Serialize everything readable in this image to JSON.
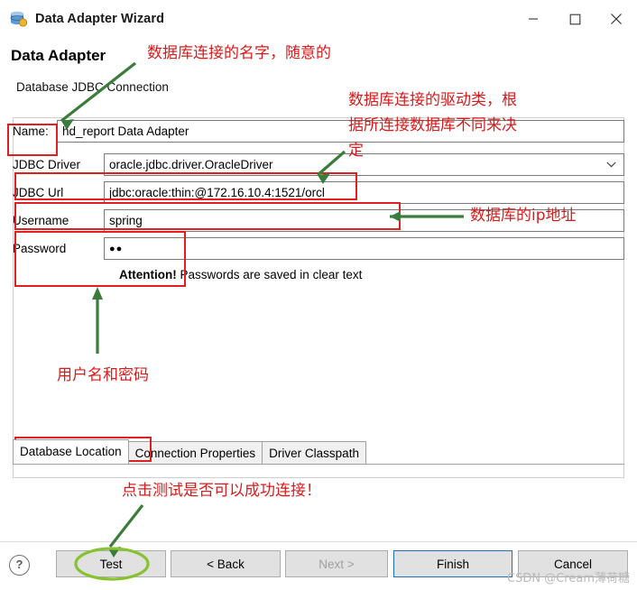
{
  "window": {
    "title": "Data Adapter Wizard",
    "icon": "database-adapter-icon",
    "minimize_label": "–",
    "maximize_label": "☐",
    "close_label": "✕"
  },
  "wizard": {
    "heading": "Data Adapter",
    "subheading": "Database JDBC Connection"
  },
  "form": {
    "name_label": "Name:",
    "name_value": "hd_report Data Adapter",
    "driver_label": "JDBC Driver",
    "driver_value": "oracle.jdbc.driver.OracleDriver",
    "driver_arrow": "⌄",
    "url_label": "JDBC Url",
    "url_value": "jdbc:oracle:thin:@172.16.10.4:1521/orcl",
    "username_label": "Username",
    "username_value": "spring",
    "password_label": "Password",
    "password_value": "●●",
    "attention_bold": "Attention!",
    "attention_text": "Passwords are saved in clear text"
  },
  "tabs": [
    {
      "label": "Database Location",
      "active": true
    },
    {
      "label": "Connection Properties",
      "active": false
    },
    {
      "label": "Driver Classpath",
      "active": false
    }
  ],
  "footer": {
    "help_label": "?",
    "test_label": "Test",
    "back_label": "< Back",
    "next_label": "Next >",
    "finish_label": "Finish",
    "cancel_label": "Cancel"
  },
  "annotations": {
    "note_name": "数据库连接的名字，随意的",
    "note_driver_line1": "数据库连接的驱动类，根",
    "note_driver_line2": "据所连接数据库不同来决",
    "note_driver_line3": "定",
    "note_url": "数据库的ip地址",
    "note_credentials": "用户名和密码",
    "note_test": "点击测试是否可以成功连接！",
    "watermark": "CSDN @Cream薄荷糖"
  },
  "colors": {
    "annotation_red": "#d81b1b",
    "box_red": "#e02020",
    "arrow_green": "#3a7d3a",
    "ellipse_green": "#86c232",
    "accent_blue": "#1f6fb2"
  }
}
